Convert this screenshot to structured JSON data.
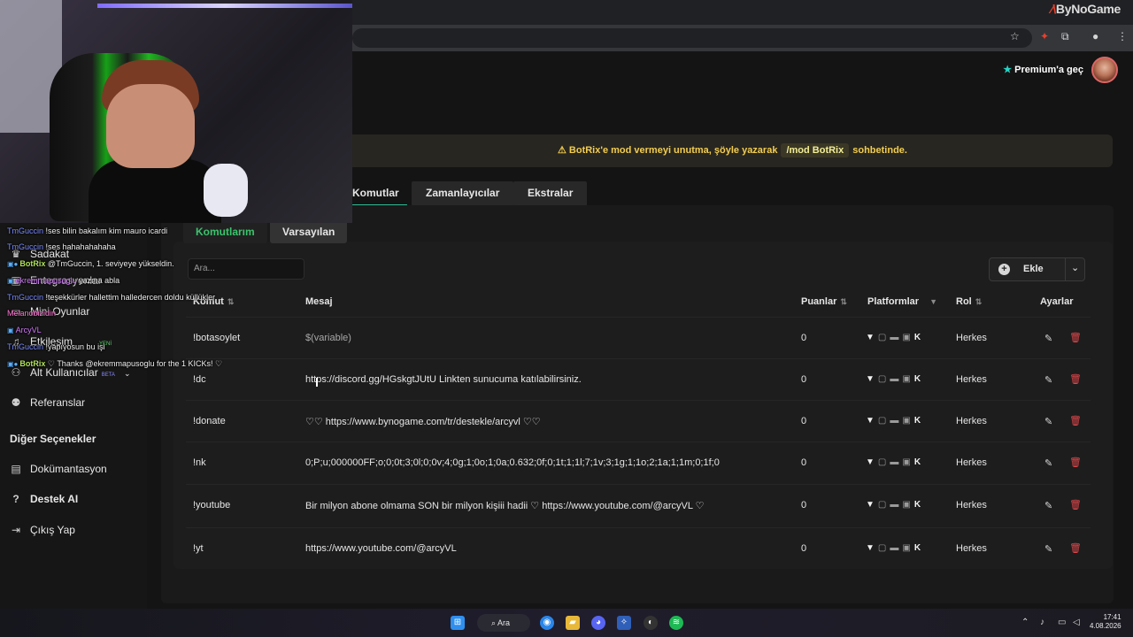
{
  "browser": {
    "brand": "ByNoGame",
    "premium_label": "Premium'a geç"
  },
  "sidebar": {
    "items_top": [
      {
        "label": "Sadakat",
        "icon": "trophy-icon"
      },
      {
        "label": "Entegrasyonlar",
        "icon": "plug-icon"
      },
      {
        "label": "Mini Oyunlar",
        "icon": "gamepad-icon"
      },
      {
        "label": "Etkileşim",
        "icon": "music-icon",
        "badge": "YENİ"
      },
      {
        "label": "Alt Kullanıcılar",
        "icon": "users-icon",
        "badge": "BETA"
      },
      {
        "label": "Referanslar",
        "icon": "referral-icon"
      }
    ],
    "section_header": "Diğer Seçenekler",
    "items_bottom": [
      {
        "label": "Dokümantasyon",
        "icon": "document-icon"
      },
      {
        "label": "Destek AI",
        "icon": "help-icon"
      },
      {
        "label": "Çıkış Yap",
        "icon": "logout-icon"
      }
    ]
  },
  "stream_chat": [
    {
      "user": "TmGuccin",
      "text": "!ses bilin bakalım kim mauro icardi"
    },
    {
      "user": "TmGuccin",
      "text": "!ses hahahahahaha"
    },
    {
      "user": "BotRix",
      "text": "@TmGuccin, 1. seviyeye yükseldin."
    },
    {
      "user": "ekremmapusoglu",
      "text": "yazma abla"
    },
    {
      "user": "TmGuccin",
      "text": "!teşekkürler hallettim halledercen doldu küllükler"
    },
    {
      "user": "Melanobizidin",
      "text": ""
    },
    {
      "user": "ArcyVL",
      "text": ""
    },
    {
      "user": "TmGuccin",
      "text": "!yapıyosun bu işi"
    },
    {
      "user": "BotRix",
      "text": "♡ Thanks @ekremmapusoglu for the 1 KICKs! ♡"
    }
  ],
  "alert": {
    "before": "BotRix'e mod vermeyi unutma, şöyle yazarak",
    "code": "/mod BotRix",
    "after": "sohbetinde."
  },
  "tabs": [
    "Komutlar",
    "Zamanlayıcılar",
    "Ekstralar"
  ],
  "subtabs": [
    "Komutlarım",
    "Varsayılan"
  ],
  "search": {
    "placeholder": "Ara..."
  },
  "add_button": {
    "label": "Ekle"
  },
  "table": {
    "headers": {
      "command": "Komut",
      "message": "Mesaj",
      "points": "Puanlar",
      "platforms": "Platformlar",
      "role": "Rol",
      "settings": "Ayarlar"
    },
    "rows": [
      {
        "command": "!botasoylet",
        "message": "$(variable)",
        "points": "0",
        "role": "Herkes"
      },
      {
        "command": "!dc",
        "message": "https://discord.gg/HGskgtJUtU Linkten sunucuma katılabilirsiniz.",
        "points": "0",
        "role": "Herkes"
      },
      {
        "command": "!donate",
        "message": "♡♡ https://www.bynogame.com/tr/destekle/arcyvl ♡♡",
        "points": "0",
        "role": "Herkes"
      },
      {
        "command": "!nk",
        "message": "0;P;u;000000FF;o;0;0t;3;0l;0;0v;4;0g;1;0o;1;0a;0.632;0f;0;1t;1;1l;7;1v;3;1g;1;1o;2;1a;1;1m;0;1f;0",
        "points": "0",
        "role": "Herkes"
      },
      {
        "command": "!youtube",
        "message": "Bir milyon abone olmama SON bir milyon kişiii hadii ♡ https://www.youtube.com/@arcyVL ♡",
        "points": "0",
        "role": "Herkes"
      },
      {
        "command": "!yt",
        "message": "https://www.youtube.com/@arcyVL",
        "points": "0",
        "role": "Herkes"
      }
    ]
  },
  "taskbar": {
    "search_label": "Ara",
    "time": "17:41",
    "date": "4.08.2026"
  }
}
